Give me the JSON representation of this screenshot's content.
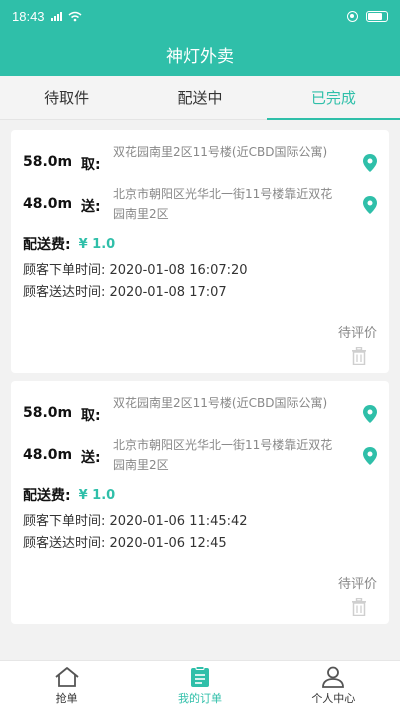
{
  "status_bar": {
    "time": "18:43",
    "signal_text": "5ııl"
  },
  "header": {
    "title": "神灯外卖"
  },
  "tabs": [
    {
      "label": "待取件",
      "active": false
    },
    {
      "label": "配送中",
      "active": false
    },
    {
      "label": "已完成",
      "active": true
    }
  ],
  "orders": [
    {
      "pickup": {
        "distance": "58.0m",
        "kind": "取:",
        "address": "双花园南里2区11号楼(近CBD国际公寓)"
      },
      "delivery": {
        "distance": "48.0m",
        "kind": "送:",
        "address": "北京市朝阳区光华北一街11号楼靠近双花园南里2区"
      },
      "fee_label": "配送费:",
      "fee_value": "¥ 1.0",
      "order_time": "顾客下单时间: 2020-01-08 16:07:20",
      "arrive_time": "顾客送达时间: 2020-01-08 17:07",
      "status": "待评价"
    },
    {
      "pickup": {
        "distance": "58.0m",
        "kind": "取:",
        "address": "双花园南里2区11号楼(近CBD国际公寓)"
      },
      "delivery": {
        "distance": "48.0m",
        "kind": "送:",
        "address": "北京市朝阳区光华北一街11号楼靠近双花园南里2区"
      },
      "fee_label": "配送费:",
      "fee_value": "¥ 1.0",
      "order_time": "顾客下单时间: 2020-01-06 11:45:42",
      "arrive_time": "顾客送达时间: 2020-01-06 12:45",
      "status": "待评价"
    }
  ],
  "bottom_nav": [
    {
      "label": "抢单",
      "icon": "home-icon",
      "active": false
    },
    {
      "label": "我的订单",
      "icon": "order-list-icon",
      "active": true
    },
    {
      "label": "个人中心",
      "icon": "person-icon",
      "active": false
    }
  ],
  "colors": {
    "accent": "#2fbfa9",
    "pin": "#2fbfa9"
  }
}
